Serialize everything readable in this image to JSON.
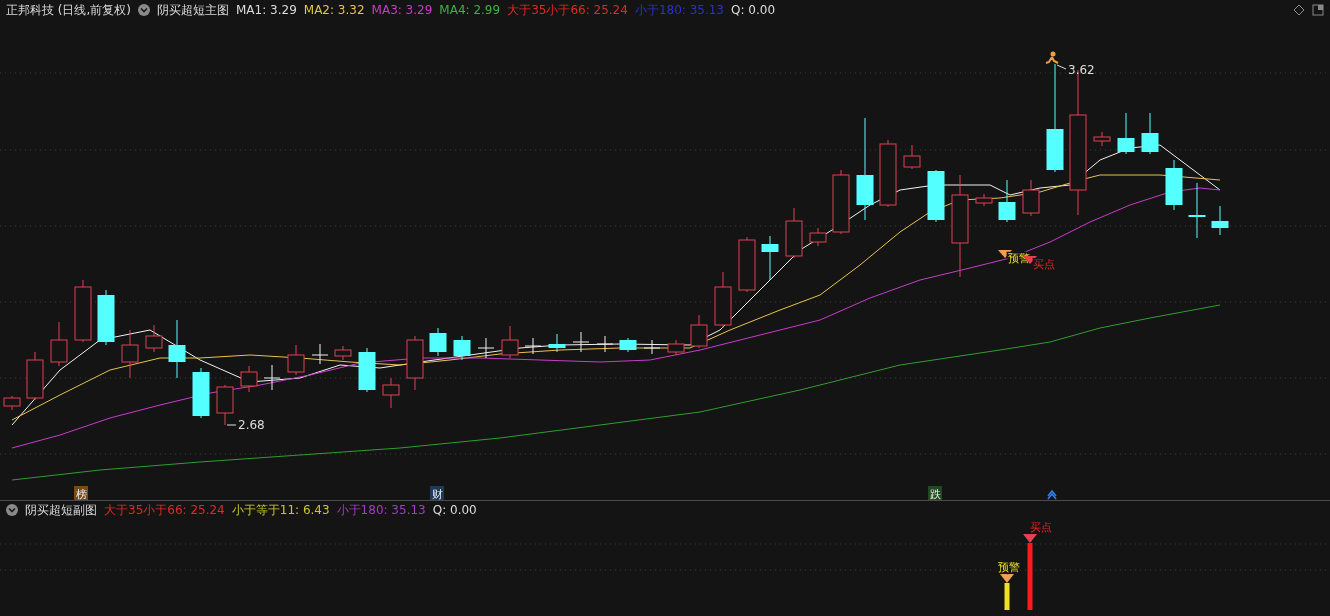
{
  "main_panel": {
    "stock_title": "正邦科技 (日线,前复权)",
    "indicator_name": "阴买超短主图",
    "readings": [
      {
        "label": "MA1: 3.29",
        "color": "#dcdcdc"
      },
      {
        "label": "MA2: 3.32",
        "color": "#e6c34a"
      },
      {
        "label": "MA3: 3.29",
        "color": "#c83cc8"
      },
      {
        "label": "MA4: 2.99",
        "color": "#3cb43c"
      },
      {
        "label": "大于35小于66: 25.24",
        "color": "#e02828"
      },
      {
        "label": "小于180: 35.13",
        "color": "#2d32c8"
      },
      {
        "label": "Q: 0.00",
        "color": "#dcdcdc"
      }
    ],
    "high_label": "3.62",
    "low_label": "2.68",
    "signals": [
      {
        "label": "预警",
        "kind": "warning"
      },
      {
        "label": "买点",
        "kind": "buy"
      }
    ],
    "event_markers": [
      {
        "label": "榜",
        "color": "#7a4a14"
      },
      {
        "label": "财",
        "color": "#1e3a5a"
      },
      {
        "label": "跌",
        "color": "#1e4a1e"
      }
    ]
  },
  "sub_panel": {
    "indicator_name": "阴买超短副图",
    "readings": [
      {
        "label": "大于35小于66: 25.24",
        "color": "#e02828"
      },
      {
        "label": "小于等于11: 6.43",
        "color": "#c8c828"
      },
      {
        "label": "小于180: 35.13",
        "color": "#a03cc8"
      },
      {
        "label": "Q: 0.00",
        "color": "#dcdcdc"
      }
    ],
    "signals": [
      {
        "label": "预警",
        "kind": "warning"
      },
      {
        "label": "买点",
        "kind": "buy"
      }
    ]
  }
}
